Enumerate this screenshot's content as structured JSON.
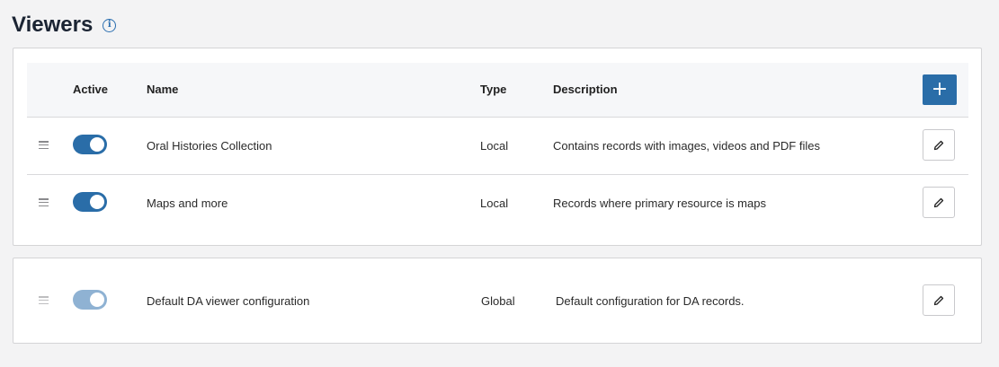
{
  "page": {
    "title": "Viewers",
    "info_icon": "info-icon",
    "accent_color": "#2a6da8"
  },
  "table": {
    "columns": {
      "active": "Active",
      "name": "Name",
      "type": "Type",
      "description": "Description"
    },
    "add_button_label": "+",
    "rows": [
      {
        "active": true,
        "name": "Oral Histories Collection",
        "type": "Local",
        "description": "Contains records with images, videos and PDF files"
      },
      {
        "active": true,
        "name": "Maps and more",
        "type": "Local",
        "description": "Records where primary resource is maps"
      }
    ]
  },
  "global_viewer": {
    "active": true,
    "disabled": true,
    "name": "Default DA viewer configuration",
    "type": "Global",
    "description": "Default configuration for DA records."
  }
}
